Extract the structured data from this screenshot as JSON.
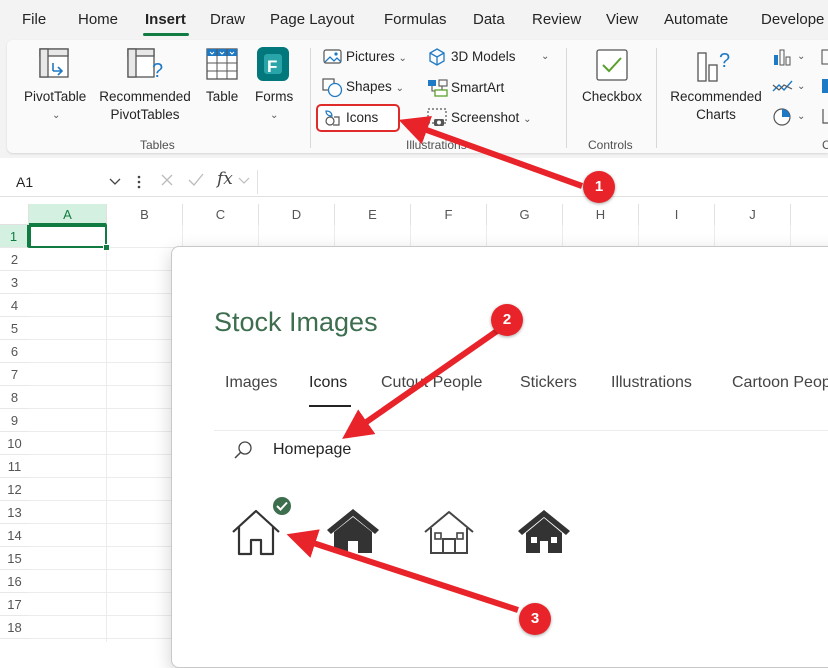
{
  "menu": {
    "tabs": [
      "File",
      "Home",
      "Insert",
      "Draw",
      "Page Layout",
      "Formulas",
      "Data",
      "Review",
      "View",
      "Automate",
      "Develope"
    ],
    "active": "Insert"
  },
  "ribbon": {
    "tables_group": {
      "pivottable": "PivotTable",
      "recommended_line1": "Recommended",
      "recommended_line2": "PivotTables",
      "table": "Table",
      "forms": "Forms",
      "name": "Tables"
    },
    "illustrations_group": {
      "pictures": "Pictures",
      "shapes": "Shapes",
      "icons": "Icons",
      "models3d": "3D Models",
      "smartart": "SmartArt",
      "screenshot": "Screenshot",
      "name": "Illustrations"
    },
    "controls_group": {
      "checkbox": "Checkbox",
      "name": "Controls"
    },
    "charts_group": {
      "rec_line1": "Recommended",
      "rec_line2": "Charts",
      "name_partial": "C"
    }
  },
  "formula_bar": {
    "cell_ref": "A1",
    "fx": "fx"
  },
  "grid": {
    "columns": [
      "A",
      "B",
      "C",
      "D",
      "E",
      "F",
      "G",
      "H",
      "I",
      "J"
    ],
    "rows": [
      "1",
      "2",
      "3",
      "4",
      "5",
      "6",
      "7",
      "8",
      "9",
      "10",
      "11",
      "12",
      "13",
      "14",
      "15",
      "16",
      "17",
      "18"
    ]
  },
  "dialog": {
    "title": "Stock Images",
    "tabs": [
      "Images",
      "Icons",
      "Cutout People",
      "Stickers",
      "Illustrations",
      "Cartoon Peop"
    ],
    "active_tab": "Icons",
    "search_value": "Homepage",
    "results": [
      "house-outline-icon",
      "house-filled-icon",
      "house-outline-windows-icon",
      "house-filled-windows-icon"
    ],
    "selected_result": 0
  },
  "annotations": {
    "badge1": "1",
    "badge2": "2",
    "badge3": "3"
  },
  "colors": {
    "excel_green": "#107c41",
    "annotation_red": "#e8242a",
    "title_green": "#3d6e4e"
  }
}
